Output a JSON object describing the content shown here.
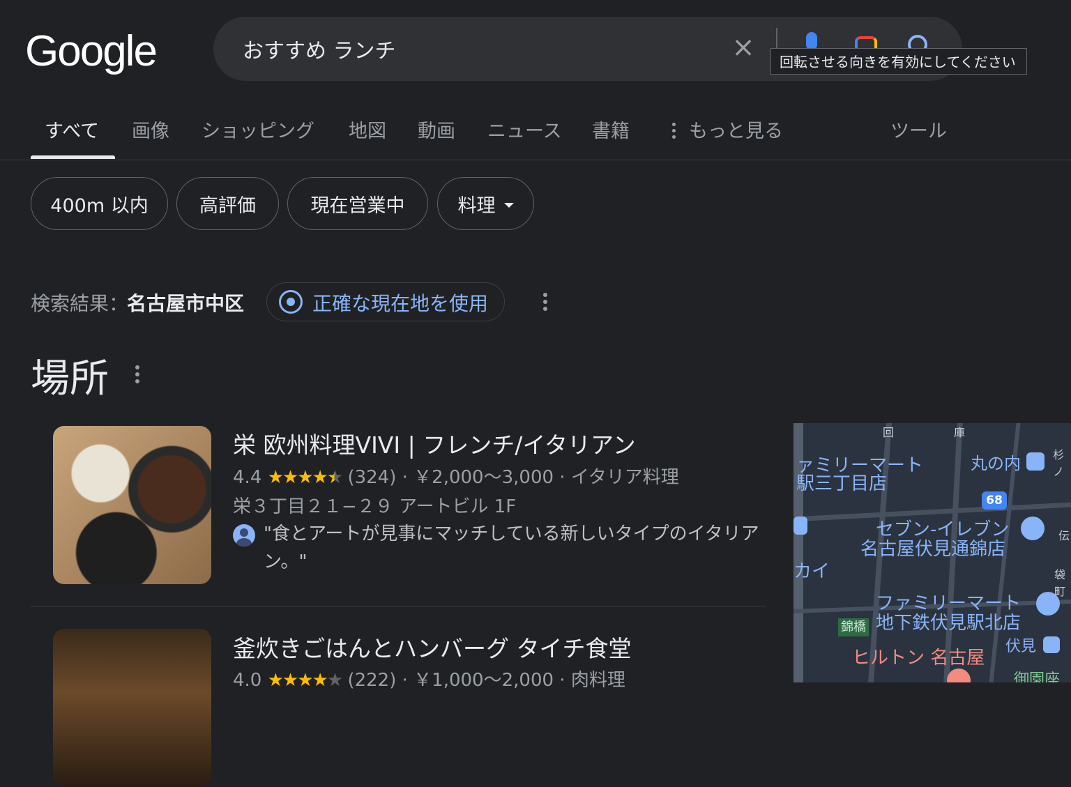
{
  "header": {
    "logo": "Google",
    "query": "おすすめ ランチ",
    "tooltip": "回転させる向きを有効にしてください"
  },
  "tabs": [
    "すべて",
    "画像",
    "ショッピング",
    "地図",
    "動画",
    "ニュース",
    "書籍",
    "もっと見る",
    "ツール"
  ],
  "chips": [
    "400m 以内",
    "高評価",
    "現在営業中",
    "料理"
  ],
  "location": {
    "label": "検索結果：",
    "place": "名古屋市中区",
    "button": "正確な現在地を使用"
  },
  "places": {
    "title": "場所",
    "results": [
      {
        "name": "栄 欧州料理VIVI | フレンチ/イタリアン",
        "rating": "4.4",
        "reviews": "(324)",
        "price": "￥2,000～3,000",
        "category": "イタリア料理",
        "address": "栄３丁目２１−２９ アートビル 1F",
        "review": "\"食とアートが見事にマッチしている新しいタイプのイタリアン。\""
      },
      {
        "name": "釜炊きごはんとハンバーグ タイチ食堂",
        "rating": "4.0",
        "reviews": "(222)",
        "price": "￥1,000～2,000",
        "category": "肉料理"
      }
    ]
  },
  "map": {
    "labels": {
      "family1": "ァミリーマート",
      "family1b": "駅三丁目店",
      "marunouchi": "丸の内",
      "seven1": "セブン-イレブン",
      "seven2": "名古屋伏見通錦店",
      "kai": "カイ",
      "family2": "ファミリーマート",
      "family2b": "地下鉄伏見駅北店",
      "nishiki": "錦橋",
      "hilton": "ヒルトン 名古屋",
      "fushimi": "伏見",
      "misono": "御園座",
      "route": "68"
    }
  }
}
